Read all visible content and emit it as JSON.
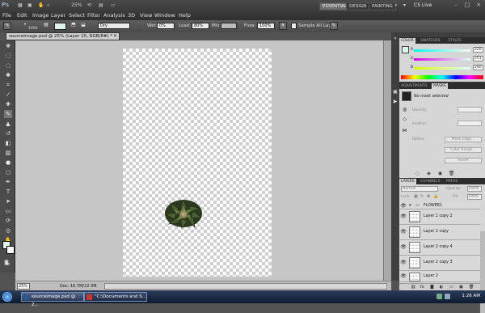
{
  "app": {
    "logo": "Ps",
    "menu": [
      "File",
      "Edit",
      "Image",
      "Layer",
      "Select",
      "Filter",
      "Analysis",
      "3D",
      "View",
      "Window",
      "Help"
    ],
    "zoom_top": "25%",
    "workspaces": [
      "ESSENTIALS",
      "DESIGN",
      "PAINTING"
    ],
    "cs_live": "CS Live"
  },
  "options": {
    "brush_size": "1000",
    "mode_value": "Dry",
    "wet_label": "Wet:",
    "wet_value": "0%",
    "load_label": "Load:",
    "load_value": "80%",
    "mix_label": "Mix:",
    "flow_label": "Flow:",
    "flow_value": "100%",
    "sample_label": "Sample All Layers"
  },
  "document": {
    "tab_title": "sourceimage.psd @ 25% (Layer 15, RGB/8#) *",
    "zoom": "25%",
    "info": "Doc: 16.7M/22.3M"
  },
  "panels": {
    "color_tabs": [
      "COLOR",
      "SWATCHES",
      "STYLES"
    ],
    "r_label": "R",
    "g_label": "G",
    "b_label": "B",
    "r_value": "220",
    "g_value": "251",
    "b_value": "240",
    "adjust_tabs": [
      "ADJUSTMENTS",
      "MASKS"
    ],
    "no_mask": "No mask selected",
    "density_label": "Density:",
    "feather_label": "Feather:",
    "refine_label": "Refine:",
    "mask_edge": "Mask Edge...",
    "color_range": "Color Range...",
    "invert": "Invert",
    "layers_tabs": [
      "LAYERS",
      "CHANNELS",
      "PATHS"
    ],
    "blend_mode": "Normal",
    "opacity_label": "Opacity:",
    "opacity_value": "100%",
    "lock_label": "Lock:",
    "fill_label": "Fill:",
    "fill_value": "100%",
    "layers": [
      "FLOWER1",
      "Layer 2 copy 2",
      "Layer 2 copy",
      "Layer 2 copy 4",
      "Layer 2 copy 3",
      "Layer 2"
    ]
  },
  "taskbar": {
    "tasks": [
      "sourceimage.psd @ 2...",
      "\"C:\\Documents and S..."
    ],
    "clock": "1:26 AM"
  },
  "colors": {
    "foreground": "#dcfbf0",
    "accent": "#3399ff"
  }
}
